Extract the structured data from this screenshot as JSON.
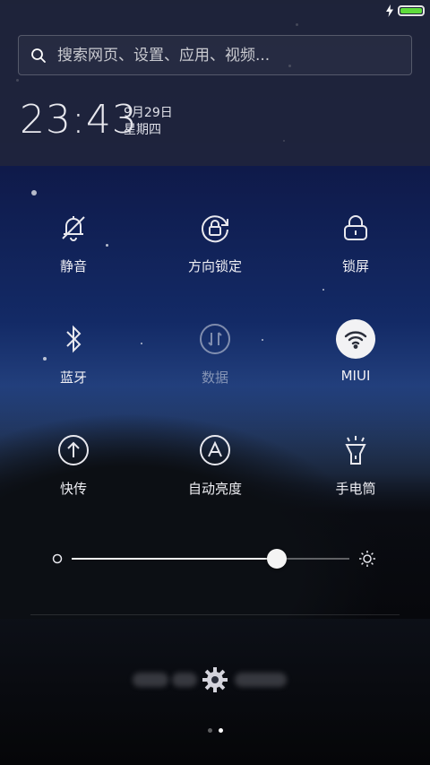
{
  "status_bar": {
    "charging_icon": "bolt-icon",
    "battery_level": 1.0,
    "battery_color": "#5fdc3c"
  },
  "search": {
    "placeholder": "搜索网页、设置、应用、视频..."
  },
  "clock": {
    "time": "23:43",
    "date": "9月29日",
    "weekday": "星期四"
  },
  "toggles": [
    {
      "id": "mute",
      "label": "静音",
      "icon": "bell-off-icon",
      "state": "off"
    },
    {
      "id": "rotation",
      "label": "方向锁定",
      "icon": "rotation-lock-icon",
      "state": "off"
    },
    {
      "id": "lock",
      "label": "锁屏",
      "icon": "lock-icon",
      "state": "off"
    },
    {
      "id": "bluetooth",
      "label": "蓝牙",
      "icon": "bluetooth-icon",
      "state": "off"
    },
    {
      "id": "data",
      "label": "数据",
      "icon": "data-icon",
      "state": "disabled"
    },
    {
      "id": "wifi",
      "label": "MIUI",
      "icon": "wifi-icon",
      "state": "on"
    },
    {
      "id": "quickshare",
      "label": "快传",
      "icon": "upload-icon",
      "state": "off"
    },
    {
      "id": "autobrightness",
      "label": "自动亮度",
      "icon": "auto-brightness-icon",
      "state": "off"
    },
    {
      "id": "flashlight",
      "label": "手电筒",
      "icon": "flashlight-icon",
      "state": "off"
    }
  ],
  "brightness": {
    "level": 0.74,
    "min_icon": "brightness-low-icon",
    "max_icon": "brightness-high-icon"
  },
  "toolbar": {
    "settings_icon": "gear-icon"
  },
  "pager": {
    "count": 2,
    "active_index": 1
  }
}
